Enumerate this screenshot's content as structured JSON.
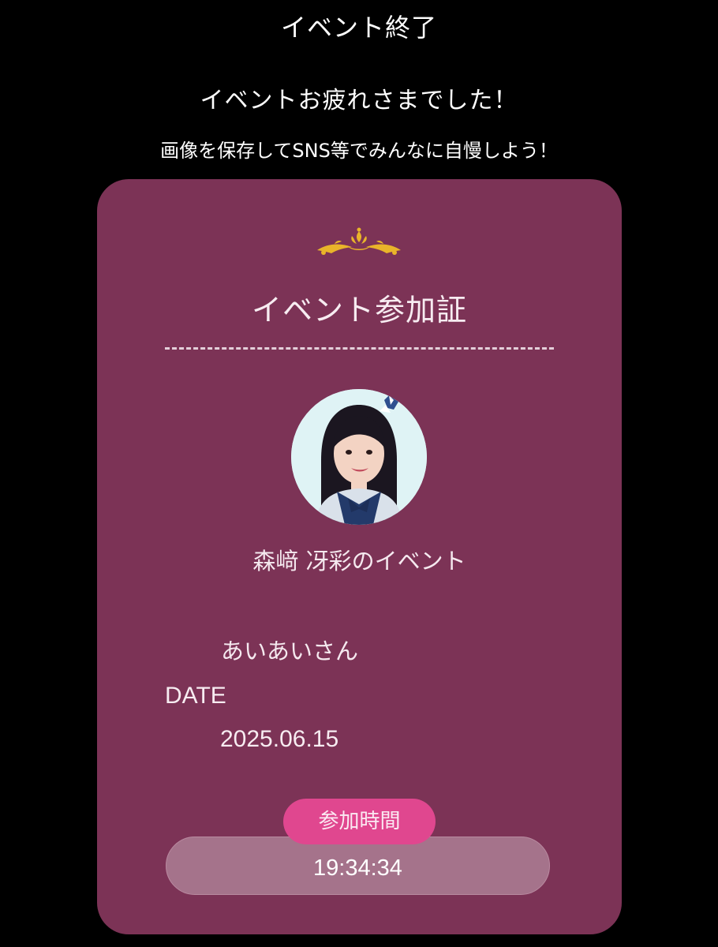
{
  "header": {
    "title": "イベント終了",
    "message": "イベントお疲れさまでした！",
    "subtitle": "画像を保存してSNS等でみんなに自慢しよう！"
  },
  "card": {
    "title": "イベント参加証",
    "event_name": "森﨑 冴彩のイベント",
    "user_name": "あいあいさん",
    "date_label": "DATE",
    "date_value": "2025.06.15",
    "time_label": "参加時間",
    "time_value": "19:34:34",
    "ornament_icon": "crown-ornament-icon",
    "avatar_icon": "member-avatar-photo"
  },
  "colors": {
    "background": "#000000",
    "card": "#7c3356",
    "accent_pink": "#e0478f",
    "time_box": "#a5738b",
    "ornament_gold": "#e9b42a"
  }
}
